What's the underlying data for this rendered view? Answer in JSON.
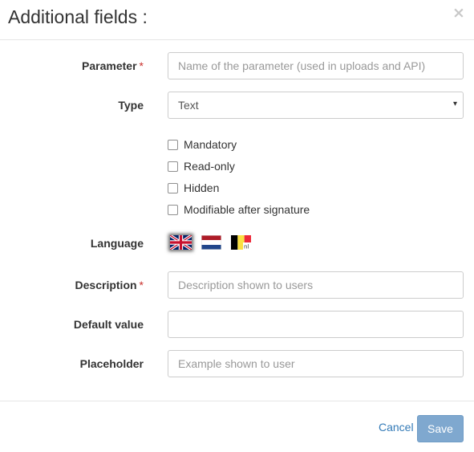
{
  "header": {
    "title": "Additional fields :",
    "close_label": "×"
  },
  "form": {
    "parameter": {
      "label": "Parameter",
      "required_mark": "*",
      "placeholder": "Name of the parameter (used in uploads and API)",
      "value": ""
    },
    "type": {
      "label": "Type",
      "selected": "Text",
      "caret": "▾"
    },
    "checkboxes": [
      {
        "label": "Mandatory",
        "checked": false
      },
      {
        "label": "Read-only",
        "checked": false
      },
      {
        "label": "Hidden",
        "checked": false
      },
      {
        "label": "Modifiable after signature",
        "checked": false
      }
    ],
    "language": {
      "label": "Language",
      "flags": [
        {
          "name": "uk-flag-icon",
          "selected": true
        },
        {
          "name": "netherlands-flag-icon",
          "selected": false
        },
        {
          "name": "belgium-flag-icon",
          "selected": false,
          "badge": "nl"
        }
      ]
    },
    "description": {
      "label": "Description",
      "required_mark": "*",
      "placeholder": "Description shown to users",
      "value": ""
    },
    "default_value": {
      "label": "Default value",
      "placeholder": "",
      "value": ""
    },
    "placeholder_field": {
      "label": "Placeholder",
      "placeholder": "Example shown to user",
      "value": ""
    }
  },
  "footer": {
    "cancel_label": "Cancel",
    "save_label": "Save"
  },
  "colors": {
    "link": "#337ab7",
    "save_button": "#7fa8cf",
    "required": "#c9302c"
  }
}
